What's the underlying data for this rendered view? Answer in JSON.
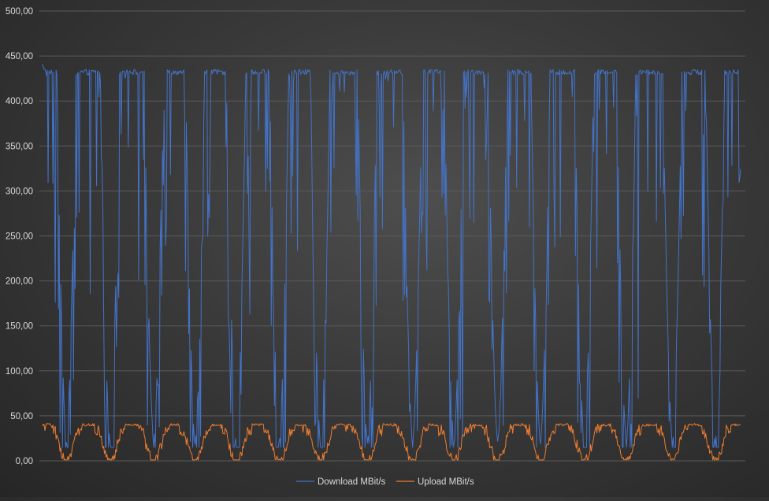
{
  "chart_data": {
    "type": "line",
    "title": "",
    "xlabel": "",
    "ylabel": "",
    "ylim": [
      0,
      500
    ],
    "y_ticks": [
      "0,00",
      "50,00",
      "100,00",
      "150,00",
      "200,00",
      "250,00",
      "300,00",
      "350,00",
      "400,00",
      "450,00",
      "500,00"
    ],
    "y_tick_values": [
      0,
      50,
      100,
      150,
      200,
      250,
      300,
      350,
      400,
      450,
      500
    ],
    "grid": true,
    "legend_position": "bottom",
    "num_points": 880,
    "series": [
      {
        "name": "Download MBit/s",
        "color": "#4472c4",
        "pattern": "repeating cycles: ~430 plateau with sharp dips, falling to ~20-30 at each trough",
        "trough_indices": [
          30,
          85,
          140,
          192,
          244,
          298,
          350,
          409,
          466,
          518,
          573,
          627,
          682,
          735,
          793,
          847
        ],
        "plateau": 432,
        "trough_min": 20,
        "start": 440,
        "end": 320
      },
      {
        "name": "Upload MBit/s",
        "color": "#ed7d31",
        "pattern": "repeating cycles: ~40 plateau dipping to ~3-20 at each trough",
        "trough_indices": [
          30,
          85,
          140,
          192,
          244,
          298,
          350,
          409,
          466,
          518,
          573,
          627,
          682,
          735,
          793,
          847
        ],
        "plateau": 40,
        "trough_min": 3,
        "start": 40,
        "end": 40
      }
    ]
  }
}
